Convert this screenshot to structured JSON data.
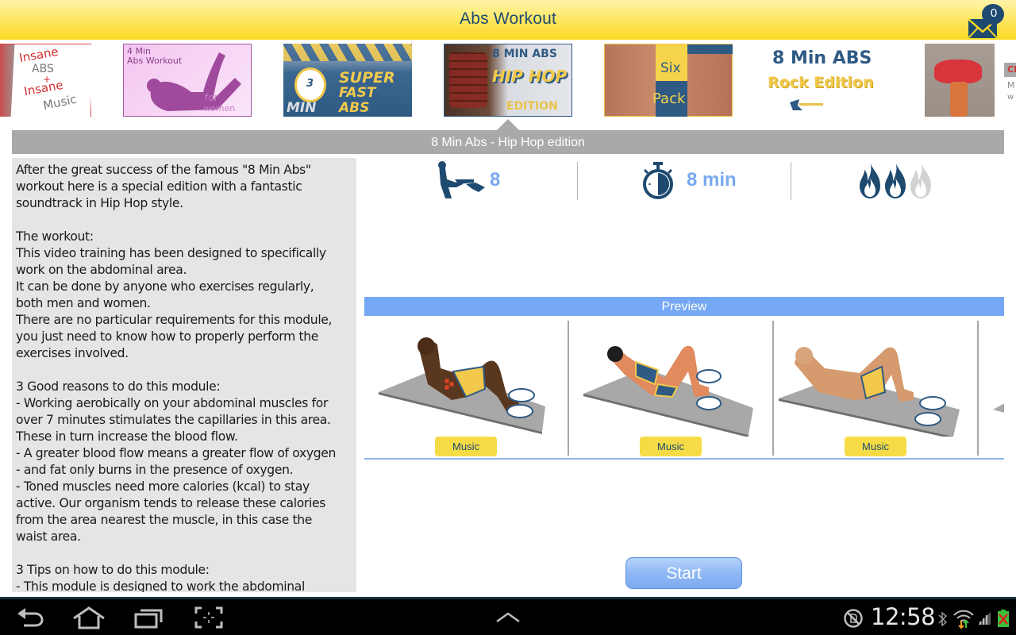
{
  "header": {
    "title": "Abs Workout",
    "mail_icon": "mail-envelope-icon",
    "notification_count": "0"
  },
  "colors": {
    "header_yellow": "#fbd91f",
    "brand_navy": "#1e4a70",
    "accent_blue": "#75a8f4",
    "stat_blue": "#79a9ef",
    "music_yellow": "#f5dc46",
    "title_gray": "#a9a9a9"
  },
  "workouts": [
    {
      "id": "insane-abs",
      "lines": [
        "Insane",
        "ABS",
        "+",
        "Insane",
        "Music"
      ],
      "selected": false
    },
    {
      "id": "4-min-abs-women",
      "lines": [
        "4 Min",
        "Abs Workout",
        "for",
        "women"
      ],
      "selected": false
    },
    {
      "id": "super-fast-abs",
      "lines": [
        "3",
        "SUPER",
        "FAST",
        "MIN",
        "ABS"
      ],
      "selected": false
    },
    {
      "id": "8-min-abs-hiphop",
      "lines": [
        "8 MIN ABS",
        "HIP HOP",
        "EDITION"
      ],
      "selected": true
    },
    {
      "id": "six-pack",
      "lines": [
        "Six",
        "Pack"
      ],
      "selected": false
    },
    {
      "id": "8-min-abs-rock",
      "lines": [
        "8 Min ABS",
        "Rock Edition"
      ],
      "selected": false
    },
    {
      "id": "chest-mini",
      "lines": [
        "CHES",
        "M i",
        "w o r"
      ],
      "selected": false
    }
  ],
  "selected_title": "8 Min Abs - Hip Hop edition",
  "description": "After the great success of the famous \"8 Min Abs\"\nworkout here is a special edition with a fantastic\nsoundtrack in Hip Hop style.\n\nThe workout:\nThis video training has been designed to specifically\nwork on the abdominal area.\nIt can be done by anyone who exercises regularly,\nboth men and women.\nThere are no particular requirements for this module,\nyou just need to know how to properly perform the\nexercises involved.\n\n3 Good reasons to do this module:\n- Working aerobically on your abdominal muscles for\nover 7 minutes stimulates the capillaries in this area.\nThese in turn increase the blood flow.\n- A greater blood flow means a greater flow of oxygen\n- and fat only burns in the presence of oxygen.\n- Toned muscles need more calories (kcal) to stay\nactive. Our organism tends to release these calories\nfrom the area nearest the muscle, in this case the\nwaist area.\n\n3 Tips on how to do this module:\n- This module is designed to work the abdominal",
  "stats": {
    "exercises": {
      "icon": "situp-figure-icon",
      "value": "8"
    },
    "duration": {
      "icon": "stopwatch-icon",
      "value": "8 min"
    },
    "difficulty": {
      "icon": "flame-icon",
      "level": 2,
      "max": 3
    }
  },
  "preview": {
    "header": "Preview",
    "items": [
      {
        "label": "Music",
        "figure": "dark-skin-male-crunch"
      },
      {
        "label": "Music",
        "figure": "female-crunch"
      },
      {
        "label": "Music",
        "figure": "bald-male-crunch"
      }
    ]
  },
  "start_label": "Start",
  "system_bar": {
    "nav": [
      "back-icon",
      "home-icon",
      "recent-apps-icon",
      "screenshot-icon"
    ],
    "expand_icon": "chevron-up-icon",
    "time": "12:58",
    "status_icons": [
      "no-sim-icon",
      "bluetooth-icon",
      "wifi-icon",
      "signal-icon",
      "battery-icon"
    ]
  }
}
